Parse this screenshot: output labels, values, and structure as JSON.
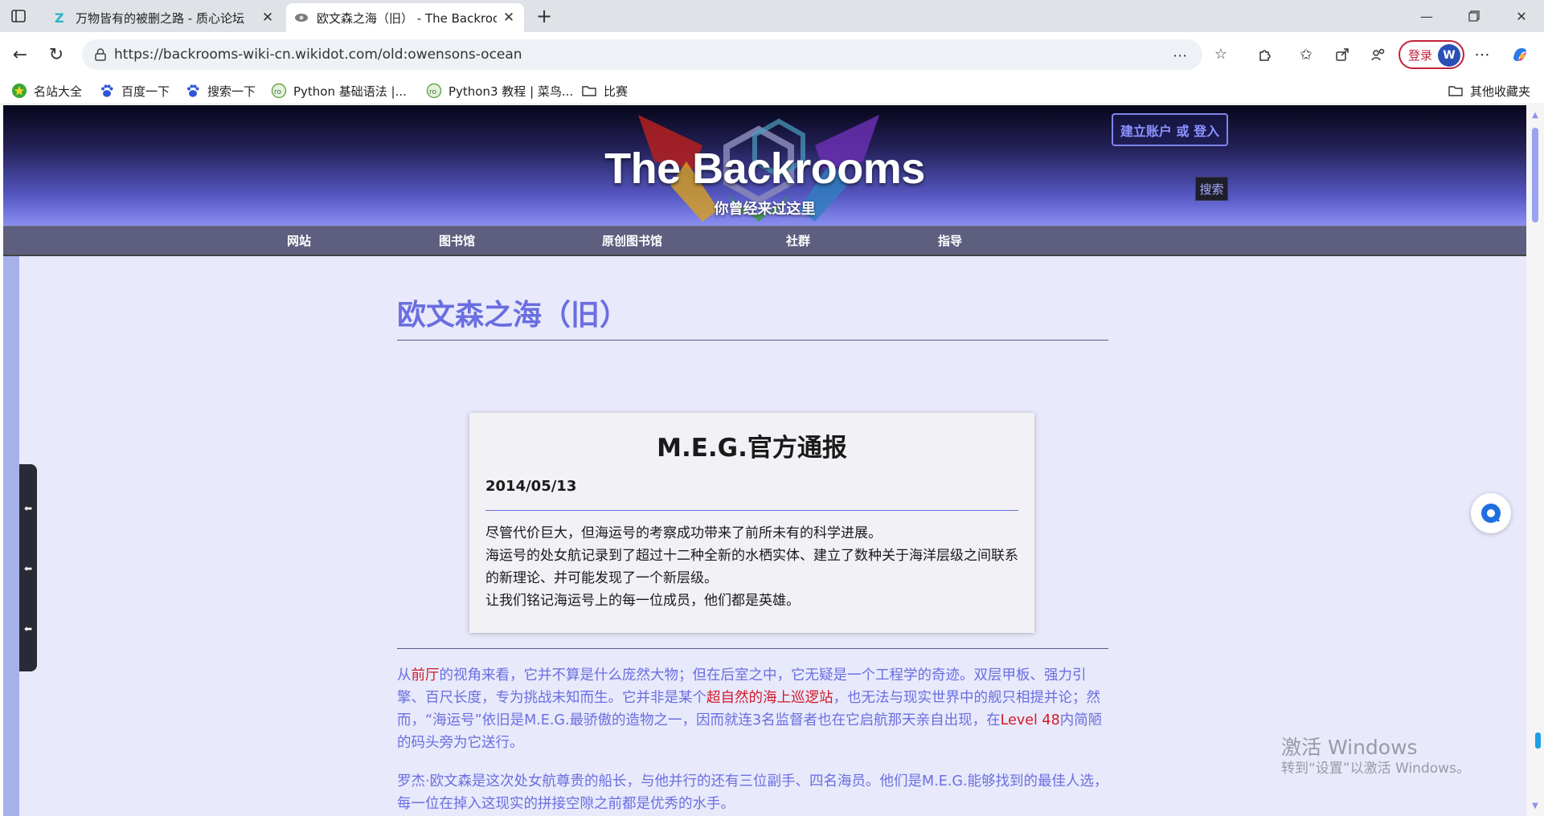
{
  "browser": {
    "tabs": [
      {
        "title": "万物皆有的被删之路 - 质心论坛"
      },
      {
        "title": "欧文森之海（旧） - The Backroom"
      }
    ],
    "url": "https://backrooms-wiki-cn.wikidot.com/old:owensons-ocean",
    "login_label": "登录",
    "avatar_letter": "W"
  },
  "bookmarks": {
    "items": [
      {
        "label": "名站大全"
      },
      {
        "label": "百度一下"
      },
      {
        "label": "搜索一下"
      },
      {
        "label": "Python 基础语法 |..."
      },
      {
        "label": "Python3 教程 | 菜鸟..."
      },
      {
        "label": "比赛"
      }
    ],
    "other_label": "其他收藏夹"
  },
  "site": {
    "title": "The Backrooms",
    "subtitle": "你曾经来过这里",
    "account_label": "建立账户 或 登入",
    "search_label": "搜索",
    "nav": [
      {
        "label": "网站"
      },
      {
        "label": "图书馆"
      },
      {
        "label": "原创图书馆"
      },
      {
        "label": "社群"
      },
      {
        "label": "指导"
      }
    ]
  },
  "article": {
    "title": "欧文森之海（旧）",
    "notice": {
      "title": "M.E.G.官方通报",
      "date": "2014/05/13",
      "lines": [
        "尽管代价巨大，但海运号的考察成功带来了前所未有的科学进展。",
        "海运号的处女航记录到了超过十二种全新的水栖实体、建立了数种关于海洋层级之间联系的新理论、并可能发现了一个新层级。",
        "让我们铭记海运号上的每一位成员，他们都是英雄。"
      ]
    },
    "p1": {
      "a": "从",
      "link1": "前厅",
      "b": "的视角来看，它并不算是什么庞然大物；但在后室之中，它无疑是一个工程学的奇迹。双层甲板、强力引擎、百尺长度，专为挑战未知而生。它并非是某个",
      "link2": "超自然的海上巡逻站",
      "c": "，也无法与现实世界中的舰只相提并论；然而，“海运号”依旧是M.E.G.最骄傲的造物之一，因而就连3名监督者也在它启航那天亲自出现，在",
      "link3": "Level 48",
      "d": "内简陋的码头旁为它送行。"
    },
    "p2": "罗杰·欧文森是这次处女航尊贵的船长，与他并行的还有三位副手、四名海员。他们是M.E.G.能够找到的最佳人选，每一位在掉入这现实的拼接空隙之前都是优秀的水手。"
  },
  "watermark": {
    "line1": "激活 Windows",
    "line2": "转到“设置”以激活 Windows。"
  }
}
